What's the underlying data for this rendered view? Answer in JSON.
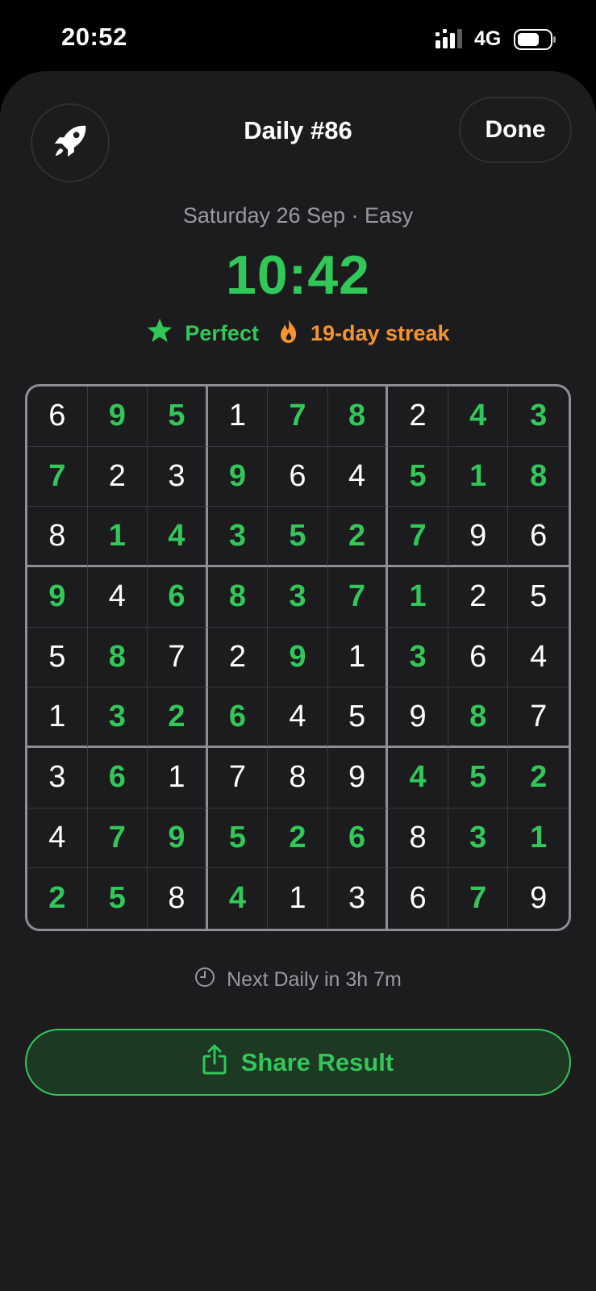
{
  "status_bar": {
    "time": "20:52",
    "network": "4G"
  },
  "header": {
    "title": "Daily #86",
    "done_label": "Done"
  },
  "puzzle_info": {
    "subtitle": "Saturday 26 Sep · Easy",
    "timer": "10:42",
    "result_label": "Perfect",
    "streak_label": "19-day streak"
  },
  "board": {
    "digits": [
      [
        6,
        9,
        5,
        1,
        7,
        8,
        2,
        4,
        3
      ],
      [
        7,
        2,
        3,
        9,
        6,
        4,
        5,
        1,
        8
      ],
      [
        8,
        1,
        4,
        3,
        5,
        2,
        7,
        9,
        6
      ],
      [
        9,
        4,
        6,
        8,
        3,
        7,
        1,
        2,
        5
      ],
      [
        5,
        8,
        7,
        2,
        9,
        1,
        3,
        6,
        4
      ],
      [
        1,
        3,
        2,
        6,
        4,
        5,
        9,
        8,
        7
      ],
      [
        3,
        6,
        1,
        7,
        8,
        9,
        4,
        5,
        2
      ],
      [
        4,
        7,
        9,
        5,
        2,
        6,
        8,
        3,
        1
      ],
      [
        2,
        5,
        8,
        4,
        1,
        3,
        6,
        7,
        9
      ]
    ],
    "green": [
      [
        0,
        1,
        1,
        0,
        1,
        1,
        0,
        1,
        1
      ],
      [
        1,
        0,
        0,
        1,
        0,
        0,
        1,
        1,
        1
      ],
      [
        0,
        1,
        1,
        1,
        1,
        1,
        1,
        0,
        0
      ],
      [
        1,
        0,
        1,
        1,
        1,
        1,
        1,
        0,
        0
      ],
      [
        0,
        1,
        0,
        0,
        1,
        0,
        1,
        0,
        0
      ],
      [
        0,
        1,
        1,
        1,
        0,
        0,
        0,
        1,
        0
      ],
      [
        0,
        1,
        0,
        0,
        0,
        0,
        1,
        1,
        1
      ],
      [
        0,
        1,
        1,
        1,
        1,
        1,
        0,
        1,
        1
      ],
      [
        1,
        1,
        0,
        1,
        0,
        0,
        0,
        1,
        0
      ]
    ]
  },
  "footer": {
    "next_daily": "Next Daily in 3h 7m",
    "share_label": "Share Result"
  },
  "colors": {
    "accent_green": "#32c759",
    "streak_orange": "#f7932e",
    "background": "#1c1c1e"
  },
  "icons": {
    "header_left": "rocket-icon",
    "result": "star-icon",
    "streak": "flame-icon",
    "next_daily": "clock-icon",
    "share": "share-icon"
  }
}
